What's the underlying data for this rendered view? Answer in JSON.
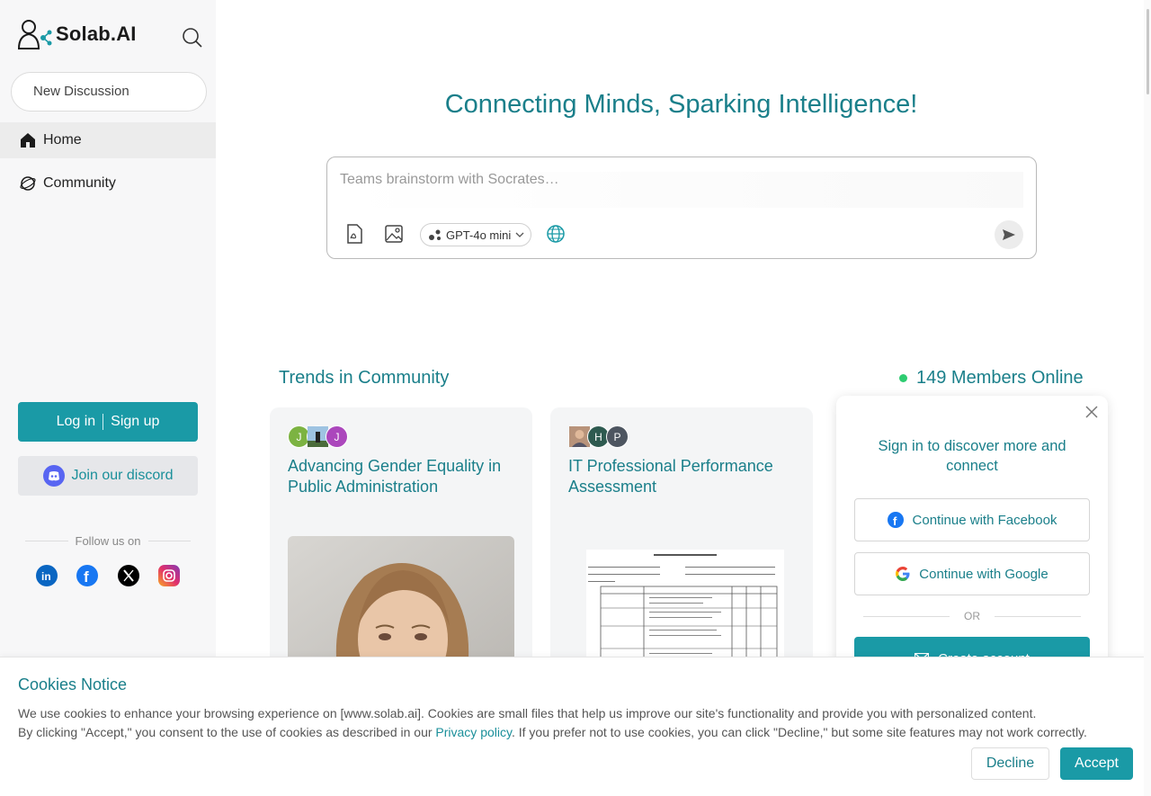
{
  "brand": {
    "name": "Solab.AI"
  },
  "sidebar": {
    "new_discussion": "New Discussion",
    "nav": [
      {
        "label": "Home",
        "icon": "home-icon",
        "active": true
      },
      {
        "label": "Community",
        "icon": "planet-icon",
        "active": false
      }
    ],
    "login": "Log in",
    "signup": "Sign up",
    "discord": "Join our discord",
    "follow_us": "Follow us on",
    "socials": [
      "linkedin-icon",
      "facebook-icon",
      "x-icon",
      "instagram-icon"
    ]
  },
  "main": {
    "headline": "Connecting Minds, Sparking Intelligence!",
    "prompt_placeholder": "Teams brainstorm with Socrates…",
    "model": "GPT-4o mini",
    "trends_title": "Trends in Community",
    "online": "149 Members Online",
    "cards": [
      {
        "title": "Advancing Gender Equality in Public Administration",
        "avatars": [
          "J",
          "",
          "J"
        ]
      },
      {
        "title": "IT Professional Performance Assessment",
        "avatars": [
          "",
          "H",
          "P"
        ]
      }
    ]
  },
  "popup": {
    "title": "Sign in to discover more and connect",
    "facebook": "Continue with Facebook",
    "google": "Continue with Google",
    "or": "OR",
    "create": "Create account"
  },
  "cookie": {
    "title": "Cookies Notice",
    "line1": "We use cookies to enhance your browsing experience on [www.solab.ai]. Cookies are small files that help us improve our site's functionality and provide you with personalized content.",
    "line2_pre": "By clicking \"Accept,\" you consent to the use of cookies as described in our ",
    "privacy_link": "Privacy policy",
    "line2_post": ". If you prefer not to use cookies, you can click \"Decline,\" but some site features may not work correctly.",
    "decline": "Decline",
    "accept": "Accept"
  },
  "colors": {
    "accent": "#1a9aa6",
    "accent_text": "#1a7f8a",
    "online_dot": "#2ecc71"
  }
}
